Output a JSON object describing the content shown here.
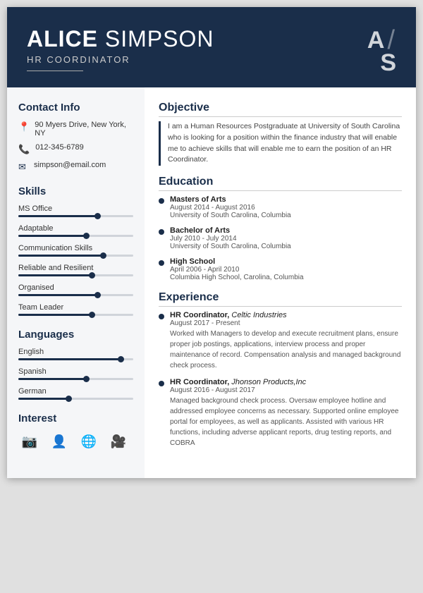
{
  "header": {
    "first_name": "ALICE",
    "last_name": "SIMPSON",
    "title": "HR COORDINATOR",
    "monogram_a": "A",
    "monogram_slash": "/",
    "monogram_s": "S"
  },
  "sidebar": {
    "contact_title": "Contact Info",
    "contact": {
      "address": "90 Myers Drive, New York, NY",
      "phone": "012-345-6789",
      "email": "simpson@email.com"
    },
    "skills_title": "Skills",
    "skills": [
      {
        "label": "MS Office",
        "pct": 70
      },
      {
        "label": "Adaptable",
        "pct": 60
      },
      {
        "label": "Communication Skills",
        "pct": 75
      },
      {
        "label": "Reliable and Resilient",
        "pct": 65
      },
      {
        "label": "Organised",
        "pct": 70
      },
      {
        "label": "Team Leader",
        "pct": 65
      }
    ],
    "languages_title": "Languages",
    "languages": [
      {
        "label": "English",
        "pct": 90
      },
      {
        "label": "Spanish",
        "pct": 60
      },
      {
        "label": "German",
        "pct": 45
      }
    ],
    "interest_title": "Interest"
  },
  "main": {
    "objective_title": "Objective",
    "objective_text": "I am a Human Resources Postgraduate at University of South Carolina who is looking for a position within the finance industry that will enable me to achieve skills that will enable me to earn the position of an HR Coordinator.",
    "education_title": "Education",
    "education": [
      {
        "degree": "Masters of Arts",
        "date": "August 2014 - August 2016",
        "school": "University of South Carolina, Columbia"
      },
      {
        "degree": "Bachelor of Arts",
        "date": "July 2010 - July 2014",
        "school": "University of South Carolina, Columbia"
      },
      {
        "degree": "High School",
        "date": "April 2006 - April 2010",
        "school": "Columbia High School, Carolina, Columbia"
      }
    ],
    "experience_title": "Experience",
    "experience": [
      {
        "title": "HR Coordinator",
        "company": "Celtic Industries",
        "date": "August 2017 - Present",
        "desc": "Worked with Managers to develop and execute recruitment plans, ensure proper job postings, applications, interview process and proper maintenance of record. Compensation analysis and managed background check process."
      },
      {
        "title": "HR Coordinator",
        "company": "Jhonson Products,Inc",
        "date": "August 2016 - August 2017",
        "desc": "Managed background check process. Oversaw employee hotline and addressed employee concerns as necessary. Supported online employee portal for employees, as well as applicants. Assisted with various HR functions, including adverse applicant reports, drug testing reports, and COBRA"
      }
    ]
  }
}
